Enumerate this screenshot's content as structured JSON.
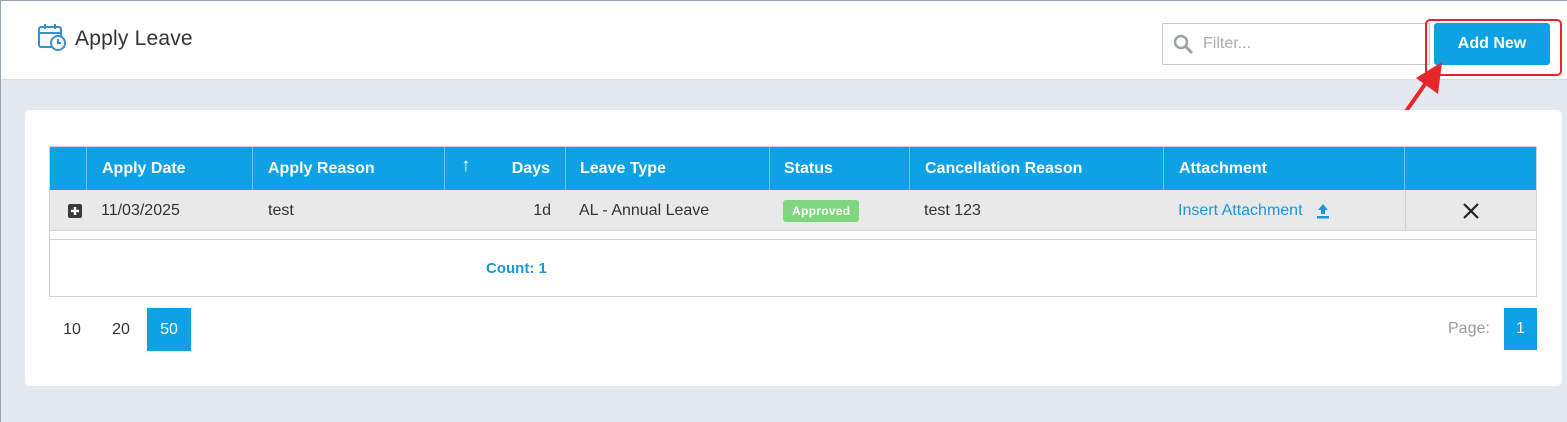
{
  "header": {
    "title": "Apply Leave",
    "filter_placeholder": "Filter...",
    "add_button": "Add New"
  },
  "grid": {
    "columns": [
      "Apply Date",
      "Apply Reason",
      "↑",
      "Days",
      "Leave Type",
      "Status",
      "Cancellation Reason",
      "Attachment"
    ],
    "rows": [
      {
        "apply_date": "11/03/2025",
        "apply_reason": "test",
        "days": "1d",
        "leave_type": "AL - Annual Leave",
        "status": "Approved",
        "cancellation_reason": "test 123",
        "attachment": "Insert Attachment"
      }
    ],
    "count": "Count: 1"
  },
  "pager": {
    "sizes": [
      "10",
      "20",
      "50"
    ],
    "active_size": "50",
    "page_label": "Page:",
    "current_page": "1"
  },
  "colors": {
    "accent": "#0ea1e3",
    "approved": "#7ed67e",
    "highlight": "#e8262a"
  },
  "icons": {
    "title": "calendar-clock-icon",
    "filter": "search-icon",
    "expand": "plus-square-icon",
    "upload": "upload-icon",
    "delete": "close-icon",
    "sort": "sort-ascending-icon",
    "annotation": "red-arrow"
  }
}
